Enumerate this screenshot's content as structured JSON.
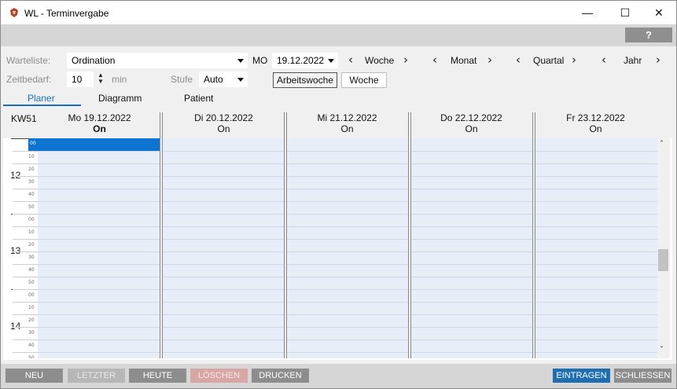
{
  "window": {
    "title": "WL - Terminvergabe",
    "controls": {
      "minimize": "—",
      "maximize": "☐",
      "close": "✕"
    }
  },
  "help": {
    "label": "?"
  },
  "form": {
    "warteliste_label": "Warteliste:",
    "warteliste_value": "Ordination",
    "day_prefix": "MO",
    "date_value": "19.12.2022",
    "zeitbedarf_label": "Zeitbedarf:",
    "zeitbedarf_value": "10",
    "zeitbedarf_unit": "min",
    "stufe_label": "Stufe",
    "stufe_value": "Auto",
    "nav": {
      "woche": "Woche",
      "monat": "Monat",
      "quartal": "Quartal",
      "jahr": "Jahr",
      "prev": "‹",
      "next": "›"
    },
    "mode_buttons": [
      "Arbeitswoche",
      "Woche"
    ]
  },
  "tabs": [
    "Planer",
    "Diagramm",
    "Patient"
  ],
  "planner": {
    "week": "KW51",
    "days": [
      {
        "date": "Mo 19.12.2022",
        "status": "On"
      },
      {
        "date": "Di 20.12.2022",
        "status": "On"
      },
      {
        "date": "Mi 21.12.2022",
        "status": "On"
      },
      {
        "date": "Do 22.12.2022",
        "status": "On"
      },
      {
        "date": "Fr 23.12.2022",
        "status": "On"
      }
    ],
    "hours": [
      "12",
      "13",
      "14"
    ],
    "minute_marks": [
      "00",
      "10",
      "20",
      "30",
      "40",
      "50"
    ],
    "selected_slot": "00"
  },
  "bottom_buttons": {
    "neu": "NEU",
    "letzter": "LETZTER",
    "heute": "HEUTE",
    "loeschen": "LÖSCHEN",
    "drucken": "DRUCKEN",
    "eintragen": "EINTRAGEN",
    "schliessen": "SCHLIESSEN"
  },
  "colors": {
    "accent": "#1a6fc0",
    "selection": "#0e74d1",
    "primary_button": "#1f6fb0",
    "cell_bg": "#e8eef7"
  }
}
